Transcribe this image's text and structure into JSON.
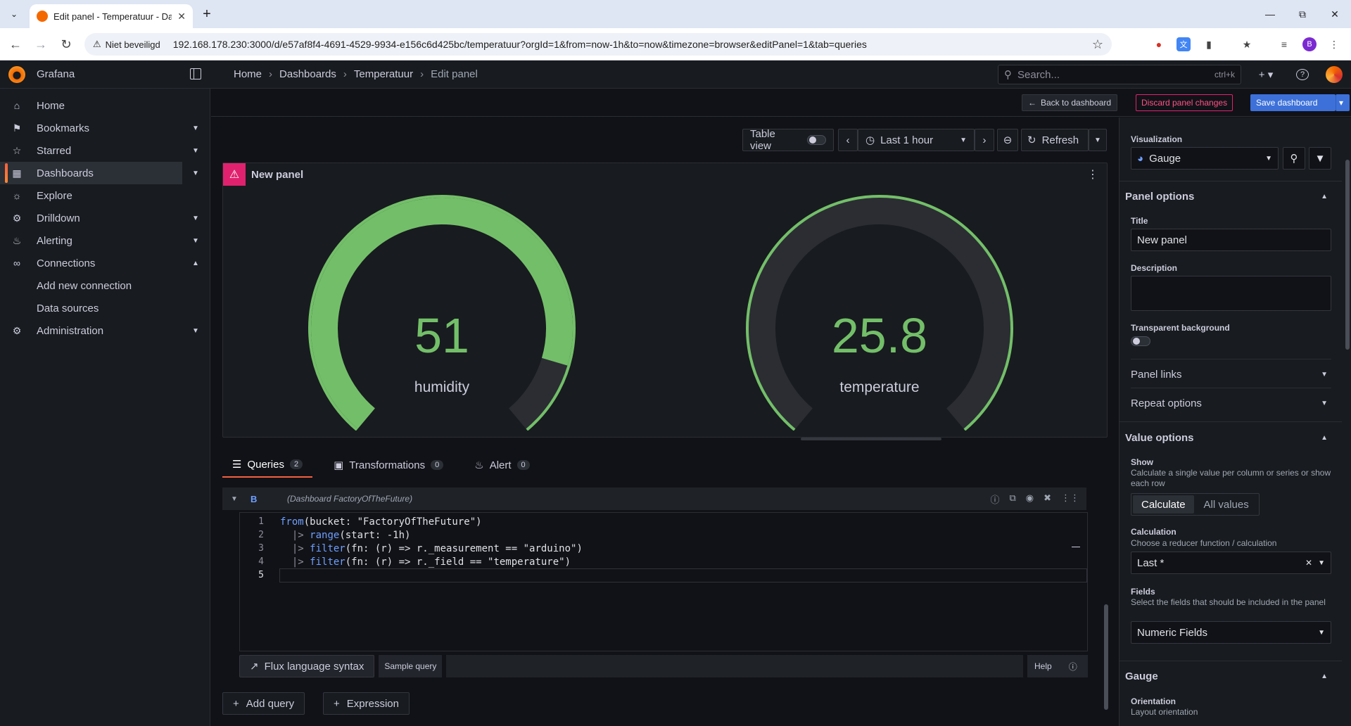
{
  "browser": {
    "tab_title": "Edit panel - Temperatuur - Dasl",
    "security_label": "Niet beveiligd",
    "url": "192.168.178.230:3000/d/e57af8f4-4691-4529-9934-e156c6d425bc/temperatuur?orgId=1&from=now-1h&to=now&timezone=browser&editPanel=1&tab=queries",
    "profile_initial": "B"
  },
  "topbar": {
    "brand": "Grafana",
    "breadcrumbs": [
      "Home",
      "Dashboards",
      "Temperatuur",
      "Edit panel"
    ],
    "search_placeholder": "Search...",
    "search_shortcut": "ctrl+k"
  },
  "sidebar": {
    "items": [
      {
        "label": "Home",
        "icon": "home-icon"
      },
      {
        "label": "Bookmarks",
        "icon": "bookmark-icon"
      },
      {
        "label": "Starred",
        "icon": "star-icon"
      },
      {
        "label": "Dashboards",
        "icon": "apps-icon"
      },
      {
        "label": "Explore",
        "icon": "compass-icon"
      },
      {
        "label": "Drilldown",
        "icon": "drilldown-icon"
      },
      {
        "label": "Alerting",
        "icon": "bell-icon"
      },
      {
        "label": "Connections",
        "icon": "connections-icon"
      },
      {
        "label": "Administration",
        "icon": "cog-icon"
      }
    ],
    "connections_sub": [
      "Add new connection",
      "Data sources"
    ]
  },
  "toolbar": {
    "back": "Back to dashboard",
    "discard": "Discard panel changes",
    "save": "Save dashboard"
  },
  "controls": {
    "table_view": "Table view",
    "time_range": "Last 1 hour",
    "refresh": "Refresh"
  },
  "panel": {
    "title": "New panel",
    "gauges": [
      {
        "value": "51",
        "label": "humidity",
        "fraction": 0.88
      },
      {
        "value": "25.8",
        "label": "temperature",
        "fraction": 0.0
      }
    ],
    "accent": "#73bf69"
  },
  "query_tabs": [
    {
      "label": "Queries",
      "count": "2"
    },
    {
      "label": "Transformations",
      "count": "0"
    },
    {
      "label": "Alert",
      "count": "0"
    }
  ],
  "query": {
    "ref": "B",
    "datasource": "(Dashboard FactoryOfTheFuture)",
    "lines": [
      {
        "n": "1",
        "pre": "",
        "fn": "from",
        "rest": "(bucket: \"FactoryOfTheFuture\")"
      },
      {
        "n": "2",
        "pre": "  |> ",
        "fn": "range",
        "rest": "(start: -1h)"
      },
      {
        "n": "3",
        "pre": "  |> ",
        "fn": "filter",
        "rest": "(fn: (r) => r._measurement == \"arduino\")"
      },
      {
        "n": "4",
        "pre": "  |> ",
        "fn": "filter",
        "rest": "(fn: (r) => r._field == \"temperature\")"
      },
      {
        "n": "5",
        "pre": "",
        "fn": "",
        "rest": ""
      }
    ],
    "syntax_btn": "Flux language syntax",
    "sample_btn": "Sample query",
    "help_btn": "Help",
    "add_query": "Add query",
    "expression": "Expression"
  },
  "options": {
    "visualization_label": "Visualization",
    "visualization": "Gauge",
    "panel_options": "Panel options",
    "title_label": "Title",
    "title_value": "New panel",
    "description_label": "Description",
    "transparent_label": "Transparent background",
    "panel_links": "Panel links",
    "repeat_options": "Repeat options",
    "value_options": "Value options",
    "show_label": "Show",
    "show_desc": "Calculate a single value per column or series or show each row",
    "show_opts": [
      "Calculate",
      "All values"
    ],
    "calc_label": "Calculation",
    "calc_desc": "Choose a reducer function / calculation",
    "calc_value": "Last *",
    "fields_label": "Fields",
    "fields_desc": "Select the fields that should be included in the panel",
    "fields_value": "Numeric Fields",
    "gauge_section": "Gauge",
    "orientation_label": "Orientation",
    "orientation_desc": "Layout orientation"
  }
}
